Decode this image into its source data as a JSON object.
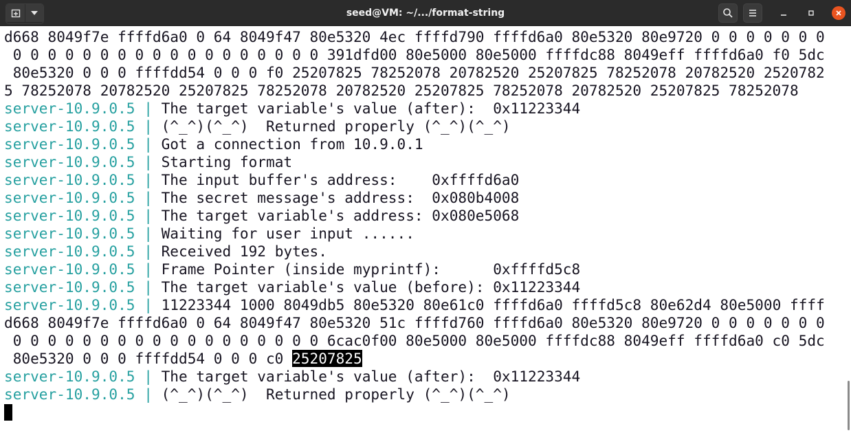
{
  "window": {
    "title": "seed@VM: ~/.../format-string"
  },
  "colors": {
    "titlebar": "#2b2b2b",
    "prefix": "#26a0a0",
    "close_button": "#e95420",
    "text": "#171421"
  },
  "icons": {
    "new_tab": "new-tab-icon",
    "menu_dropdown": "chevron-down-icon",
    "search": "search-icon",
    "hamburger": "hamburger-menu-icon",
    "minimize": "minimize-icon",
    "maximize": "maximize-icon",
    "close": "close-icon"
  },
  "terminal": {
    "lines": [
      {
        "prefix": "",
        "sep": "",
        "text": "d668 8049f7e ffffd6a0 0 64 8049f47 80e5320 4ec ffffd790 ffffd6a0 80e5320 80e9720 0 0 0 0 0 0 0"
      },
      {
        "prefix": "",
        "sep": "",
        "text": " 0 0 0 0 0 0 0 0 0 0 0 0 0 0 0 0 0 0 391dfd00 80e5000 80e5000 ffffdc88 8049eff ffffd6a0 f0 5dc"
      },
      {
        "prefix": "",
        "sep": "",
        "text": " 80e5320 0 0 0 ffffdd54 0 0 0 f0 25207825 78252078 20782520 25207825 78252078 20782520 2520782"
      },
      {
        "prefix": "",
        "sep": "",
        "text": "5 78252078 20782520 25207825 78252078 20782520 25207825 78252078 20782520 25207825 78252078"
      },
      {
        "prefix": "server-10.9.0.5",
        "sep": " | ",
        "text": "The target variable's value (after):  0x11223344"
      },
      {
        "prefix": "server-10.9.0.5",
        "sep": " | ",
        "text": "(^_^)(^_^)  Returned properly (^_^)(^_^)"
      },
      {
        "prefix": "server-10.9.0.5",
        "sep": " | ",
        "text": "Got a connection from 10.9.0.1"
      },
      {
        "prefix": "server-10.9.0.5",
        "sep": " | ",
        "text": "Starting format"
      },
      {
        "prefix": "server-10.9.0.5",
        "sep": " | ",
        "text": "The input buffer's address:    0xffffd6a0"
      },
      {
        "prefix": "server-10.9.0.5",
        "sep": " | ",
        "text": "The secret message's address:  0x080b4008"
      },
      {
        "prefix": "server-10.9.0.5",
        "sep": " | ",
        "text": "The target variable's address: 0x080e5068"
      },
      {
        "prefix": "server-10.9.0.5",
        "sep": " | ",
        "text": "Waiting for user input ......"
      },
      {
        "prefix": "server-10.9.0.5",
        "sep": " | ",
        "text": "Received 192 bytes."
      },
      {
        "prefix": "server-10.9.0.5",
        "sep": " | ",
        "text": "Frame Pointer (inside myprintf):      0xffffd5c8"
      },
      {
        "prefix": "server-10.9.0.5",
        "sep": " | ",
        "text": "The target variable's value (before): 0x11223344"
      },
      {
        "prefix": "server-10.9.0.5",
        "sep": " | ",
        "text": "11223344 1000 8049db5 80e5320 80e61c0 ffffd6a0 ffffd5c8 80e62d4 80e5000 ffff"
      },
      {
        "prefix": "",
        "sep": "",
        "text": "d668 8049f7e ffffd6a0 0 64 8049f47 80e5320 51c ffffd760 ffffd6a0 80e5320 80e9720 0 0 0 0 0 0 0"
      },
      {
        "prefix": "",
        "sep": "",
        "text": " 0 0 0 0 0 0 0 0 0 0 0 0 0 0 0 0 0 0 6cac0f00 80e5000 80e5000 ffffdc88 8049eff ffffd6a0 c0 5dc"
      },
      {
        "prefix": "",
        "sep": "",
        "text": " 80e5320 0 0 0 ffffdd54 0 0 0 c0 ",
        "highlight": "25207825"
      },
      {
        "prefix": "server-10.9.0.5",
        "sep": " | ",
        "text": "The target variable's value (after):  0x11223344"
      },
      {
        "prefix": "server-10.9.0.5",
        "sep": " | ",
        "text": "(^_^)(^_^)  Returned properly (^_^)(^_^)"
      }
    ]
  }
}
